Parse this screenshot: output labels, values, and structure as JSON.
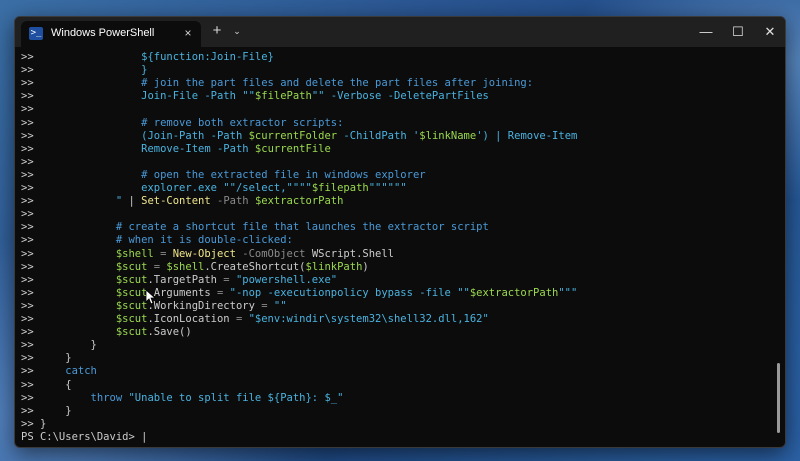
{
  "window": {
    "tab_title": "Windows PowerShell",
    "tab_icon": "powershell-icon",
    "tab_icon_glyph": ">_",
    "close_tab_glyph": "×",
    "new_tab_glyph": "+",
    "dropdown_glyph": "⌄",
    "minimize_glyph": "—",
    "maximize_glyph": "☐",
    "close_window_glyph": "✕"
  },
  "colors": {
    "terminal_bg": "#0c0c0c",
    "variable": "#9bd94f",
    "string": "#4ab3e0",
    "comment": "#4a9ad8",
    "cmdlet": "#f0e68c",
    "parameter": "#8a8a8a",
    "default": "#cccccc"
  },
  "terminal": {
    "lines": [
      [
        {
          "t": "prompt",
          "v": ">> "
        },
        {
          "t": "default",
          "v": "                "
        },
        {
          "t": "string",
          "v": "${function:Join-File}"
        }
      ],
      [
        {
          "t": "prompt",
          "v": ">> "
        },
        {
          "t": "default",
          "v": "                "
        },
        {
          "t": "string",
          "v": "}"
        }
      ],
      [
        {
          "t": "prompt",
          "v": ">> "
        },
        {
          "t": "default",
          "v": "                "
        },
        {
          "t": "comment",
          "v": "# join the part files and delete the part files after joining:"
        }
      ],
      [
        {
          "t": "prompt",
          "v": ">> "
        },
        {
          "t": "default",
          "v": "                "
        },
        {
          "t": "string",
          "v": "Join-File -Path \"\""
        },
        {
          "t": "var",
          "v": "$filePath"
        },
        {
          "t": "string",
          "v": "\"\" -Verbose -DeletePartFiles"
        }
      ],
      [
        {
          "t": "prompt",
          "v": ">>"
        }
      ],
      [
        {
          "t": "prompt",
          "v": ">> "
        },
        {
          "t": "default",
          "v": "                "
        },
        {
          "t": "comment",
          "v": "# remove both extractor scripts:"
        }
      ],
      [
        {
          "t": "prompt",
          "v": ">> "
        },
        {
          "t": "default",
          "v": "                "
        },
        {
          "t": "string",
          "v": "(Join-Path -Path "
        },
        {
          "t": "var",
          "v": "$currentFolder"
        },
        {
          "t": "string",
          "v": " -ChildPath '"
        },
        {
          "t": "var",
          "v": "$linkName"
        },
        {
          "t": "string",
          "v": "') | Remove-Item"
        }
      ],
      [
        {
          "t": "prompt",
          "v": ">> "
        },
        {
          "t": "default",
          "v": "                "
        },
        {
          "t": "string",
          "v": "Remove-Item -Path "
        },
        {
          "t": "var",
          "v": "$currentFile"
        }
      ],
      [
        {
          "t": "prompt",
          "v": ">>"
        }
      ],
      [
        {
          "t": "prompt",
          "v": ">> "
        },
        {
          "t": "default",
          "v": "                "
        },
        {
          "t": "comment",
          "v": "# open the extracted file in windows explorer"
        }
      ],
      [
        {
          "t": "prompt",
          "v": ">> "
        },
        {
          "t": "default",
          "v": "                "
        },
        {
          "t": "string",
          "v": "explorer.exe \"\"/select,\"\"\"\""
        },
        {
          "t": "var",
          "v": "$filepath"
        },
        {
          "t": "string",
          "v": "\"\"\"\"\"\""
        }
      ],
      [
        {
          "t": "prompt",
          "v": ">> "
        },
        {
          "t": "default",
          "v": "            "
        },
        {
          "t": "string",
          "v": "\""
        },
        {
          "t": "default",
          "v": " | "
        },
        {
          "t": "cmdlet",
          "v": "Set-Content"
        },
        {
          "t": "param",
          "v": " -Path "
        },
        {
          "t": "var",
          "v": "$extractorPath"
        }
      ],
      [
        {
          "t": "prompt",
          "v": ">>"
        }
      ],
      [
        {
          "t": "prompt",
          "v": ">> "
        },
        {
          "t": "default",
          "v": "            "
        },
        {
          "t": "comment",
          "v": "# create a shortcut file that launches the extractor script"
        }
      ],
      [
        {
          "t": "prompt",
          "v": ">> "
        },
        {
          "t": "default",
          "v": "            "
        },
        {
          "t": "comment",
          "v": "# when it is double-clicked:"
        }
      ],
      [
        {
          "t": "prompt",
          "v": ">> "
        },
        {
          "t": "default",
          "v": "            "
        },
        {
          "t": "var",
          "v": "$shell"
        },
        {
          "t": "op",
          "v": " = "
        },
        {
          "t": "cmdlet",
          "v": "New-Object"
        },
        {
          "t": "param",
          "v": " -ComObject "
        },
        {
          "t": "default",
          "v": "WScript.Shell"
        }
      ],
      [
        {
          "t": "prompt",
          "v": ">> "
        },
        {
          "t": "default",
          "v": "            "
        },
        {
          "t": "var",
          "v": "$scut"
        },
        {
          "t": "op",
          "v": " = "
        },
        {
          "t": "var",
          "v": "$shell"
        },
        {
          "t": "default",
          "v": ".CreateShortcut("
        },
        {
          "t": "var",
          "v": "$linkPath"
        },
        {
          "t": "default",
          "v": ")"
        }
      ],
      [
        {
          "t": "prompt",
          "v": ">> "
        },
        {
          "t": "default",
          "v": "            "
        },
        {
          "t": "var",
          "v": "$scut"
        },
        {
          "t": "default",
          "v": ".TargetPath"
        },
        {
          "t": "op",
          "v": " = "
        },
        {
          "t": "string",
          "v": "\"powershell.exe\""
        }
      ],
      [
        {
          "t": "prompt",
          "v": ">> "
        },
        {
          "t": "default",
          "v": "            "
        },
        {
          "t": "var",
          "v": "$scut"
        },
        {
          "t": "default",
          "v": ".Arguments"
        },
        {
          "t": "op",
          "v": " = "
        },
        {
          "t": "string",
          "v": "\"-nop -executionpolicy bypass -file \"\""
        },
        {
          "t": "var",
          "v": "$extractorPath"
        },
        {
          "t": "string",
          "v": "\"\"\""
        }
      ],
      [
        {
          "t": "prompt",
          "v": ">> "
        },
        {
          "t": "default",
          "v": "            "
        },
        {
          "t": "var",
          "v": "$scut"
        },
        {
          "t": "default",
          "v": ".WorkingDirectory"
        },
        {
          "t": "op",
          "v": " = "
        },
        {
          "t": "string",
          "v": "\"\""
        }
      ],
      [
        {
          "t": "prompt",
          "v": ">> "
        },
        {
          "t": "default",
          "v": "            "
        },
        {
          "t": "var",
          "v": "$scut"
        },
        {
          "t": "default",
          "v": ".IconLocation"
        },
        {
          "t": "op",
          "v": " = "
        },
        {
          "t": "string",
          "v": "\"$env:windir\\system32\\shell32.dll,162\""
        }
      ],
      [
        {
          "t": "prompt",
          "v": ">> "
        },
        {
          "t": "default",
          "v": "            "
        },
        {
          "t": "var",
          "v": "$scut"
        },
        {
          "t": "default",
          "v": ".Save()"
        }
      ],
      [
        {
          "t": "prompt",
          "v": ">> "
        },
        {
          "t": "default",
          "v": "        }"
        }
      ],
      [
        {
          "t": "prompt",
          "v": ">> "
        },
        {
          "t": "default",
          "v": "    }"
        }
      ],
      [
        {
          "t": "prompt",
          "v": ">> "
        },
        {
          "t": "default",
          "v": "    "
        },
        {
          "t": "keyword",
          "v": "catch"
        }
      ],
      [
        {
          "t": "prompt",
          "v": ">> "
        },
        {
          "t": "default",
          "v": "    {"
        }
      ],
      [
        {
          "t": "prompt",
          "v": ">> "
        },
        {
          "t": "default",
          "v": "        "
        },
        {
          "t": "keyword",
          "v": "throw"
        },
        {
          "t": "default",
          "v": " "
        },
        {
          "t": "string",
          "v": "\"Unable to split file ${Path}: $_\""
        }
      ],
      [
        {
          "t": "prompt",
          "v": ">> "
        },
        {
          "t": "default",
          "v": "    }"
        }
      ],
      [
        {
          "t": "prompt",
          "v": ">> "
        },
        {
          "t": "default",
          "v": "}"
        }
      ],
      [
        {
          "t": "prompt",
          "v": "PS C:\\Users\\David> "
        },
        {
          "t": "cursor",
          "v": "|"
        }
      ]
    ]
  }
}
